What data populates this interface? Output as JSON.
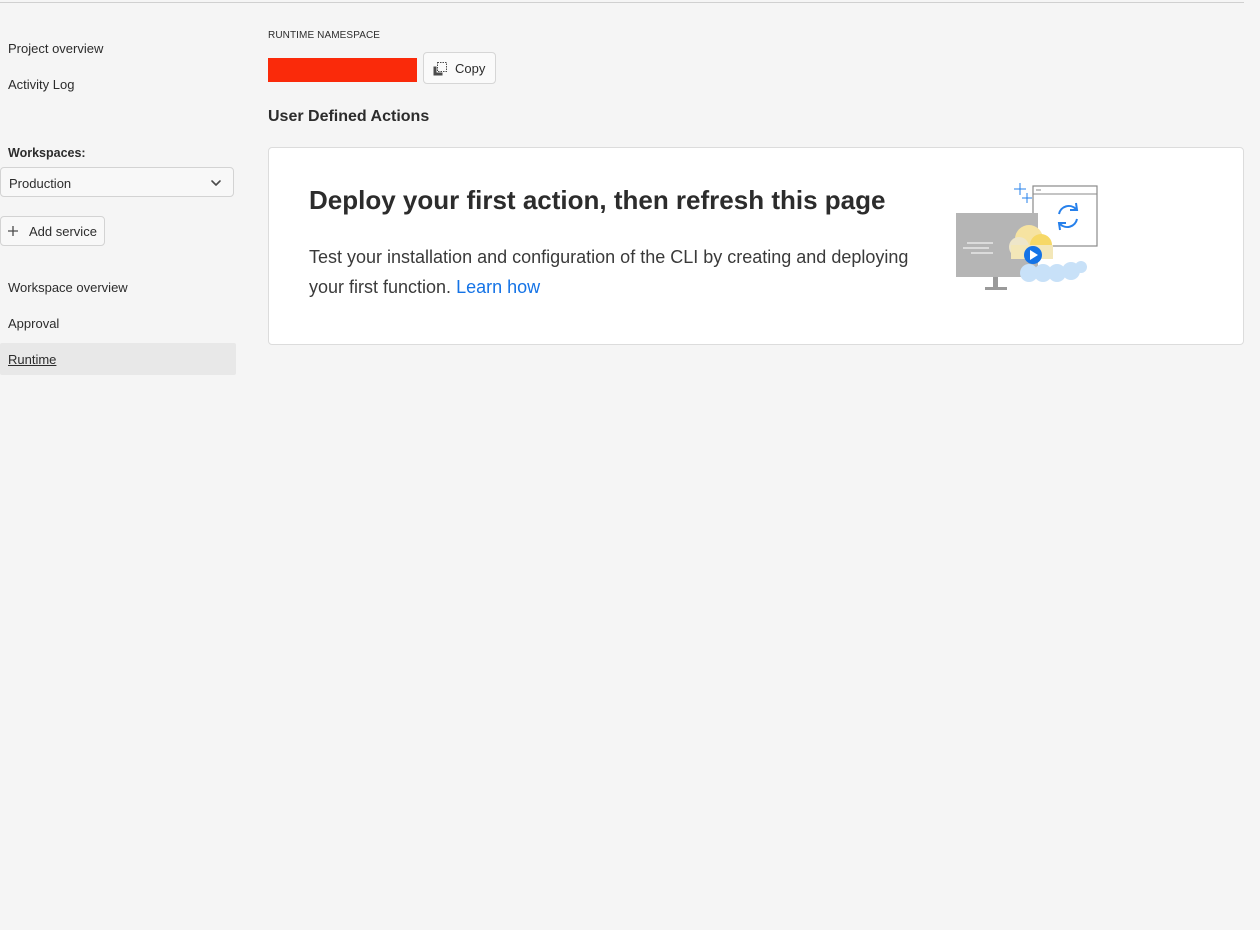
{
  "sidebar": {
    "top_links": [
      "Project overview",
      "Activity Log"
    ],
    "workspaces_label": "Workspaces:",
    "workspace_selected": "Production",
    "add_service_label": "Add service",
    "workspace_links": [
      "Workspace overview",
      "Approval",
      "Runtime"
    ],
    "active_link": "Runtime"
  },
  "main": {
    "namespace_label": "RUNTIME NAMESPACE",
    "namespace_value_redacted_color": "#fa2a0a",
    "copy_label": "Copy",
    "section_title": "User Defined Actions",
    "empty_state": {
      "heading": "Deploy your first action, then refresh this page",
      "body": "Test your installation and configuration of the CLI by creating and deploying your first function.",
      "link": "Learn how",
      "illustration": "cloud-deploy-illustration"
    }
  },
  "colors": {
    "accent": "#1473e6",
    "background": "#f5f5f5",
    "active_nav_bg": "#e8e8e8"
  },
  "icons": {
    "workspace_picker": "chevron-down-icon",
    "add_service": "plus-icon",
    "copy": "copy-icon"
  }
}
